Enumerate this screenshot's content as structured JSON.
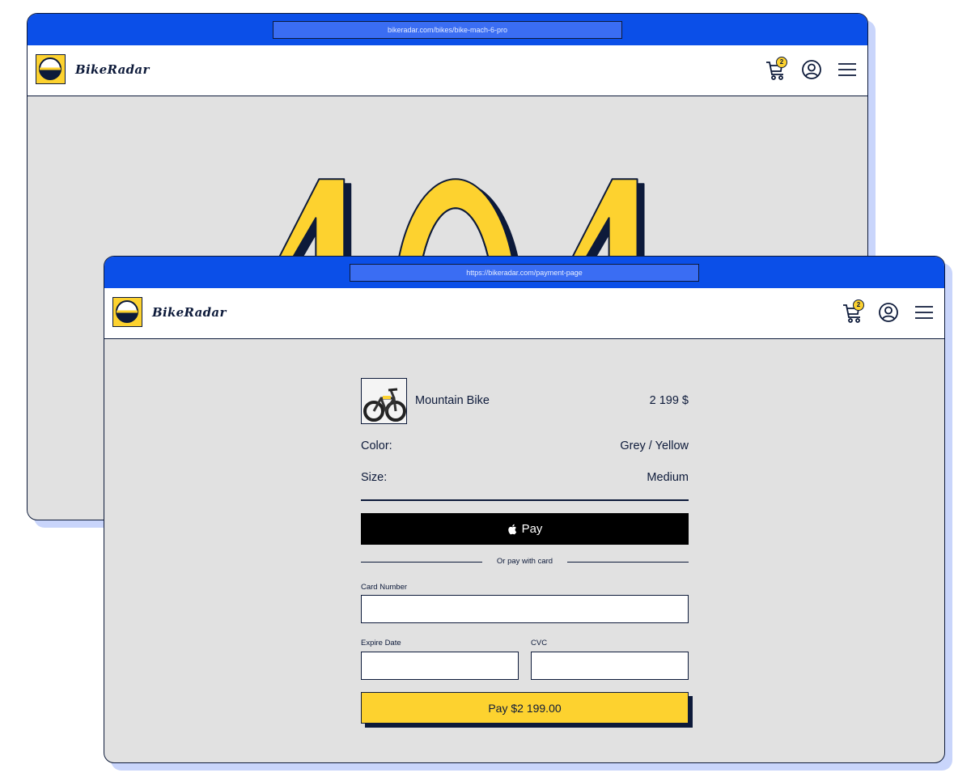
{
  "back_window": {
    "url": "bikeradar.com/bikes/bike-mach-6-pro",
    "brand": "BikeRadar",
    "cart_count": "2",
    "error_code": "404"
  },
  "front_window": {
    "url": "https://bikeradar.com/payment-page",
    "brand": "BikeRadar",
    "cart_count": "2"
  },
  "product": {
    "name": "Mountain Bike",
    "price": "2 199 $",
    "specs": [
      {
        "label": "Color:",
        "value": "Grey / Yellow"
      },
      {
        "label": "Size:",
        "value": "Medium"
      }
    ]
  },
  "payment": {
    "apple_pay_logo": "",
    "apple_pay_label": "Pay",
    "separator_text": "Or pay with card",
    "card_number_label": "Card Number",
    "card_number_value": "",
    "expire_label": "Expire Date",
    "expire_value": "",
    "cvc_label": "CVC",
    "cvc_value": "",
    "pay_button_label": "Pay $2 199.00"
  },
  "icons": {
    "logo": "bikeradar-logo-icon",
    "cart": "cart-icon",
    "account": "user-circle-icon",
    "menu": "hamburger-menu-icon",
    "apple": "apple-logo-icon"
  },
  "colors": {
    "titlebar": "#0b4fe8",
    "url_bar": "#3a6df3",
    "accent_yellow": "#fdd22f",
    "ink": "#0d1a3a",
    "page_bg": "#e1e1e1",
    "window_shadow": "#c9d5fb"
  }
}
